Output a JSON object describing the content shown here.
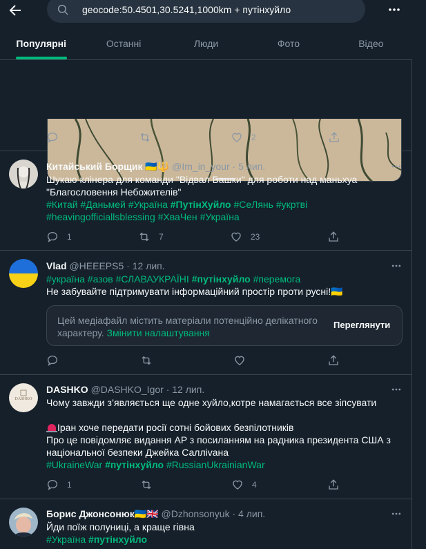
{
  "search": {
    "query": "geocode:50.4501,30.5241,1000km + путінхуйло"
  },
  "tabs": [
    {
      "label": "Популярні",
      "active": true
    },
    {
      "label": "Останні",
      "active": false
    },
    {
      "label": "Люди",
      "active": false
    },
    {
      "label": "Фото",
      "active": false
    },
    {
      "label": "Відео",
      "active": false
    }
  ],
  "tweet0": {
    "replies": "",
    "retweets": "",
    "likes": "2"
  },
  "tweet1": {
    "name": "Китайський Борщик 🇺🇦🔱",
    "handle": "@Im_in_your",
    "time": "5 лип.",
    "line1": "Шукаю клінера для команди \"Відвал Башки\" для роботи над  маньхуа",
    "line2": "\"Благословення Небожителів\"",
    "tags1": [
      "#Китай",
      "#Даньмей",
      "#Україна"
    ],
    "tag_bold": "#ПутінХуйло",
    "tags2": [
      "#СеЛянь",
      "#укртві"
    ],
    "tags3": [
      "#heavingofficiallsblessing",
      "#ХваЧен",
      "#Україна"
    ],
    "replies": "1",
    "retweets": "7",
    "likes": "23"
  },
  "tweet2": {
    "name": "Vlad",
    "handle": "@HEEEPS5",
    "time": "12 лип.",
    "tags1": [
      "#україна",
      "#азов",
      "#СЛАВАУКРАЇНІ"
    ],
    "tag_bold": "#путінхуйло",
    "tag_after": "#перемога",
    "line": "Не забувайте підтримувати інформаційний простір проти русні!🇺🇦",
    "sensitive_text": "Цей медіафайл містить матеріали потенційно делікатного характеру.",
    "sensitive_link": "Змінити налаштування",
    "sensitive_button": "Переглянути",
    "replies": "",
    "retweets": "",
    "likes": ""
  },
  "tweet3": {
    "name": "DASHKO",
    "handle": "@DASHKO_Igor",
    "time": "12 лип.",
    "line1": "Чому завжди з’являється  ще одне хуйло,котре намагається все зіпсувати",
    "line2": "Іран хоче передати росії сотні бойових безпілотників",
    "line3": "Про це повідомляє видання AP з посиланням на радника президента США з",
    "line4": "національної безпеки Джейка Салліvана",
    "tag1": "#UkraineWar",
    "tag_bold": "#путінхуйло",
    "tag2": "#RussianUkrainianWar",
    "avatar_text": "DASHKO",
    "replies": "1",
    "retweets": "",
    "likes": "4"
  },
  "tweet4": {
    "name": "Борис Джонсонюк🇺🇦🇬🇧",
    "handle": "@Dzhonsonyuk",
    "time": "4 лип.",
    "line": "Йди поїж полуниці, а краще гівна",
    "tag1": "#Україна",
    "tag_bold": "#путінхуйло"
  },
  "colors": {
    "accent": "#00ba7c",
    "background": "#15202b",
    "muted": "#8b98a5",
    "border": "#38444d"
  }
}
